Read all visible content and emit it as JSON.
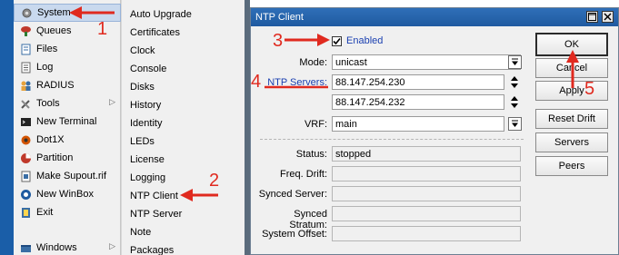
{
  "main_menu": [
    {
      "label": "System",
      "icon": "gear-icon",
      "has_sub": true,
      "selected": true
    },
    {
      "label": "Queues",
      "icon": "queues-icon"
    },
    {
      "label": "Files",
      "icon": "files-icon"
    },
    {
      "label": "Log",
      "icon": "log-icon"
    },
    {
      "label": "RADIUS",
      "icon": "radius-icon"
    },
    {
      "label": "Tools",
      "icon": "tools-icon",
      "has_sub": true
    },
    {
      "label": "New Terminal",
      "icon": "terminal-icon"
    },
    {
      "label": "Dot1X",
      "icon": "dot1x-icon"
    },
    {
      "label": "Partition",
      "icon": "partition-icon"
    },
    {
      "label": "Make Supout.rif",
      "icon": "supout-icon"
    },
    {
      "label": "New WinBox",
      "icon": "winbox-icon"
    },
    {
      "label": "Exit",
      "icon": "exit-icon"
    },
    {
      "label": "Windows",
      "icon": "windows-icon",
      "has_sub": true
    }
  ],
  "submenu": [
    "Auto Upgrade",
    "Certificates",
    "Clock",
    "Console",
    "Disks",
    "History",
    "Identity",
    "LEDs",
    "License",
    "Logging",
    "NTP Client",
    "NTP Server",
    "Note",
    "Packages"
  ],
  "dialog": {
    "title": "NTP Client",
    "enabled_label": "Enabled",
    "enabled_checked": true,
    "mode_label": "Mode:",
    "mode_value": "unicast",
    "servers_label": "NTP Servers:",
    "servers": [
      "88.147.254.230",
      "88.147.254.232"
    ],
    "vrf_label": "VRF:",
    "vrf_value": "main",
    "status_label": "Status:",
    "status_value": "stopped",
    "freq_label": "Freq. Drift:",
    "freq_value": "",
    "synced_server_label": "Synced Server:",
    "synced_server_value": "",
    "synced_stratum_label": "Synced Stratum:",
    "synced_stratum_value": "",
    "offset_label": "System Offset:",
    "offset_value": "",
    "buttons": {
      "ok": "OK",
      "cancel": "Cancel",
      "apply": "Apply",
      "reset_drift": "Reset Drift",
      "servers": "Servers",
      "peers": "Peers"
    }
  },
  "annotations": {
    "n1": "1",
    "n2": "2",
    "n3": "3",
    "n4": "4",
    "n5": "5",
    "color": "#e02a1f"
  },
  "colors": {
    "titlebar": "#2f6fb8",
    "left_strip": "#1a5ea8",
    "selection": "#c9d9ee"
  }
}
